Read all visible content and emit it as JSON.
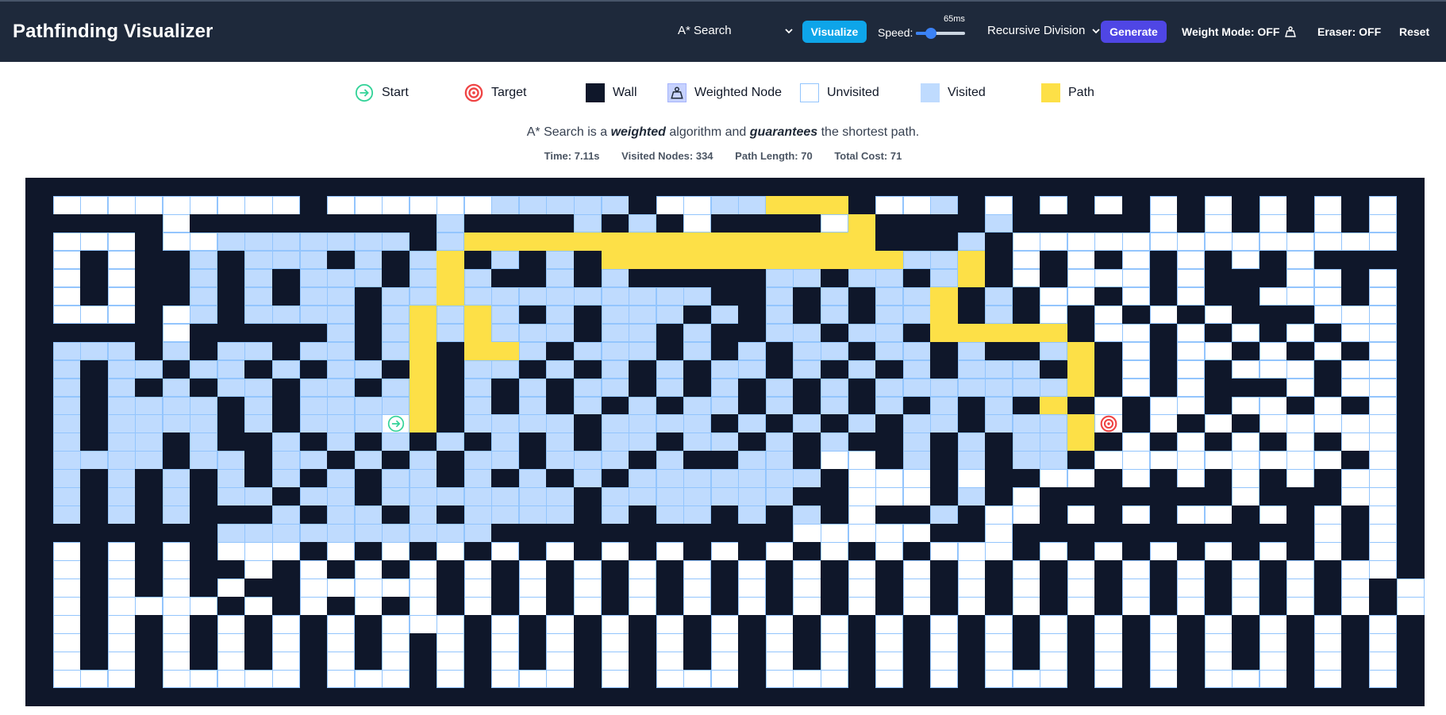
{
  "navbar": {
    "title": "Pathfinding Visualizer",
    "algorithm": "A* Search",
    "visualize_label": "Visualize",
    "speed_label": "Speed:",
    "speed_value": "65ms",
    "speed_fraction": 0.3,
    "maze": "Recursive Division",
    "generate_label": "Generate",
    "weight_mode": "Weight Mode: OFF",
    "eraser": "Eraser: OFF",
    "reset_label": "Reset"
  },
  "legend": {
    "start": "Start",
    "target": "Target",
    "wall": "Wall",
    "weighted": "Weighted Node",
    "unvisited": "Unvisited",
    "visited": "Visited",
    "path": "Path"
  },
  "description": {
    "prefix": "A* Search is a",
    "weighted": "weighted",
    "middle": "algorithm and",
    "guarantees": "guarantees",
    "suffix": "the shortest path."
  },
  "stats": {
    "time": "Time: 7.11s",
    "visited": "Visited Nodes: 334",
    "path_length": "Path Length: 70",
    "total_cost": "Total Cost: 71"
  },
  "colors": {
    "navbar": "#1e293b",
    "wall": "#0f172a",
    "unvisited": "#ffffff",
    "visited": "#bfdbfe",
    "path": "#fde047",
    "accent_visualize": "#0ea5e9",
    "accent_generate": "#4f46e5",
    "start": "#34d399",
    "target": "#ef4444"
  },
  "grid": {
    "rows": 29,
    "cols": 51,
    "start": [
      13,
      10
    ],
    "target": [
      13,
      40
    ],
    "maze": [
      "###################################################",
      "#.........#......VVVVV#..VV***#..V#.#.#.#.#.#.#.#.#",
      "#####.#########V####V#V#.####.*####V#####.#.#.#.#.#",
      "#...#..VVVVVVV#V***************###V#..............#",
      "#.#.##V#VVV#V#V*#V#V#***********VV*#.#.#.#.#.#.####",
      "#.#.##V#V#VVV#V*V##V#V#####VV#VV#V*#.#...#.###..#.#",
      "#.#.##V#V#VV#VV*VVVVVVVVV##V#V#VV*#V#..#.#.##...#.#",
      "#...#.V#VVVV#V*V*V#V#VVV#V#V#V#VV*#V#.#.#.#.###...#",
      "#####.#####V#V*V*VVV#VV#V##VV#VV#*****#..#.#.#.#..#",
      "#VVV#V#VV#VV#V*#**V#VVV#V#V#VV#VV#V##V*#.#..#.#.#.#",
      "#V#VV#VV#V#VV#*#VV#V#V#V#VV#V#V#V#VVV#*#.#.#...#..#",
      "#V#V#V#VV#VV#V*#V#V#VV#V#V#V#V#VVVVVVV*#.#.###.#..#",
      "#V#VVVV#V#VVVV*#V#V#V#V#VV#V#V#V#V#V#*#.#..#..#.#.#",
      "#V#VVVV#V#VVV@*#VVVV#VVVV#V#V#V#VV#VVV*T#.#.#.....#",
      "#V#VV#V##V#V#V#V#V#V#VV#VV#V#V##V#V#VV*#.#.#.#.#..#",
      "#VVVV#VV#VV#V#V#VV#VVV#V##VV#..#V#V#VV#.........#.#",
      "#V#V#V#V#V#V#VV#V#V#V#VVVVVVV#...#.##..#.#.#.#.#..#",
      "#V#V#V#VV#VV#VVVVVVV#VVVVVVV##...#V#.#######.###..#",
      "#V#V#V###V#VV#V#VVVV#V#VV#V#V#.##V#..#.#.#..#.#.#.#",
      "#######VVVVVVVVVV###########.....##.###########.#.#",
      "#.#.#.#...#.#.#.#.#.#.#.#.#.#.#.#...#.#.#.#.#.#.#.#",
      "#.#.#.##.#.#.#.#.#.#.#.#.#.#.#.#.#.#.#.#.#.#.#.#..#",
      "#.#.#.#.##.....#.#.#.#.#.#.#.#.#.#.#.#.#.#.#.#.#.#.",
      "#.#....#.#.#.#.#.#.#.#.#.#.#.#.#.#.#.#.#.#.#.#.#.#.",
      "#.#.#.#.#.#.#...#.#.#.#.#.#.#.#.#.#.#.#.#.#.#.#.#.#",
      "#.#.#.#.#.#.#.#.#.#.#.#.#.#.#.#.#.#.#.#.#.#.#.#.#.#",
      "#.#.#.#.#.#.#.#.#.#.#.#.#.#.#.#.#.#.#.#.#.#.#.#.#.#",
      "#...#.....#...#.#...#.#...#...#.#.#...#.#.#...#.#.#",
      "###################################################"
    ]
  }
}
